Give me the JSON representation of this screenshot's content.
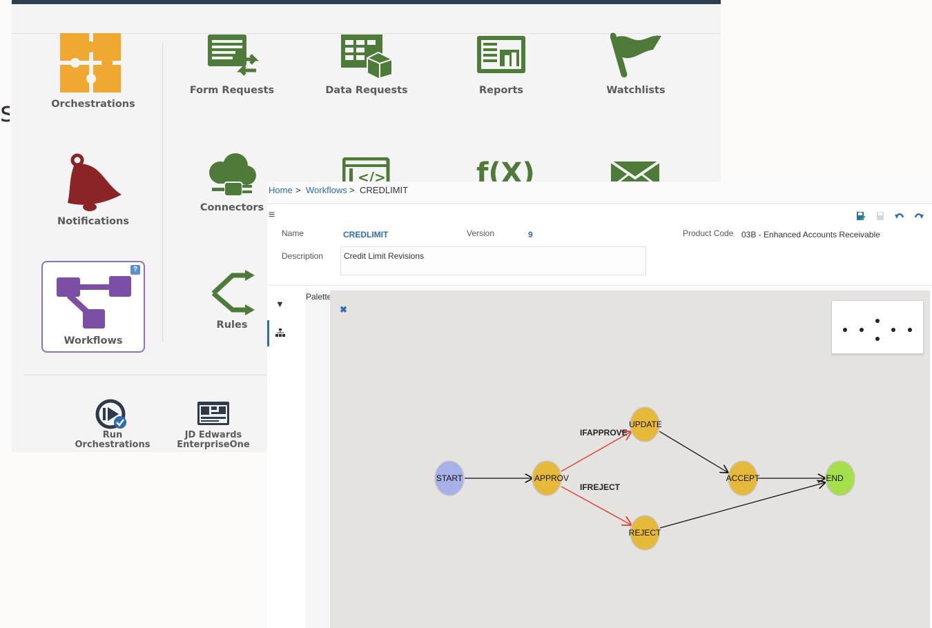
{
  "slide_fragment": "s",
  "launcher": {
    "tiles": [
      {
        "label": "Orchestrations",
        "icon": "puzzle-icon",
        "color": "#f0a830"
      },
      {
        "label": "Form Requests",
        "icon": "form-request-icon",
        "color": "#4e7a3a"
      },
      {
        "label": "Data Requests",
        "icon": "data-request-icon",
        "color": "#4e7a3a"
      },
      {
        "label": "Reports",
        "icon": "report-icon",
        "color": "#4e7a3a"
      },
      {
        "label": "Watchlists",
        "icon": "flag-icon",
        "color": "#4e7a3a"
      },
      {
        "label": "Notifications",
        "icon": "bell-icon",
        "color": "#8b2424"
      },
      {
        "label": "Connectors",
        "icon": "cloud-plug-icon",
        "color": "#4e7a3a"
      },
      {
        "label": "Workflows",
        "icon": "workflow-icon",
        "color": "#7b4fa5"
      },
      {
        "label": "Rules",
        "icon": "rules-arrows-icon",
        "color": "#4e7a3a"
      }
    ],
    "partial_icons": [
      "code-window-icon",
      "function-icon",
      "envelope-icon"
    ],
    "function_glyph": "f(X)",
    "help_badge": "?",
    "bottom_items": [
      {
        "label_line1": "Run",
        "label_line2": "Orchestrations",
        "icon": "run-orchestration-icon"
      },
      {
        "label_line1": "JD Edwards",
        "label_line2": "EnterpriseOne",
        "icon": "jde-form-icon"
      }
    ]
  },
  "designer": {
    "breadcrumb": {
      "home": "Home",
      "sep": ">",
      "workflows": "Workflows",
      "current": "CREDLIMIT"
    },
    "toolbar": {
      "save": "save-icon",
      "save_disabled": "save-disabled-icon",
      "undo": "undo-icon",
      "redo": "redo-icon"
    },
    "fields": {
      "name_label": "Name",
      "name_value": "CREDLIMIT",
      "version_label": "Version",
      "version_value": "9",
      "product_code_label": "Product Code",
      "product_code_value": "03B - Enhanced Accounts Receivable",
      "description_label": "Description",
      "description_value": "Credit Limit Revisions"
    },
    "palette_label": "Palette",
    "graph": {
      "nodes": [
        {
          "id": "start",
          "label": "START",
          "color": "#a7b0e8"
        },
        {
          "id": "approve",
          "label": "APPROV",
          "color": "#e7b93b"
        },
        {
          "id": "update",
          "label": "UPDATE",
          "color": "#e7b93b"
        },
        {
          "id": "reject",
          "label": "REJECT",
          "color": "#e7b93b"
        },
        {
          "id": "accept",
          "label": "ACCEPT",
          "color": "#e7b93b"
        },
        {
          "id": "end",
          "label": "END",
          "color": "#a5e04a"
        }
      ],
      "edge_labels": {
        "ifapprove": "IFAPPROVE",
        "ifreject": "IFREJECT"
      },
      "edge_colors": {
        "conditional": "#e0443c",
        "normal": "#111111"
      }
    }
  }
}
